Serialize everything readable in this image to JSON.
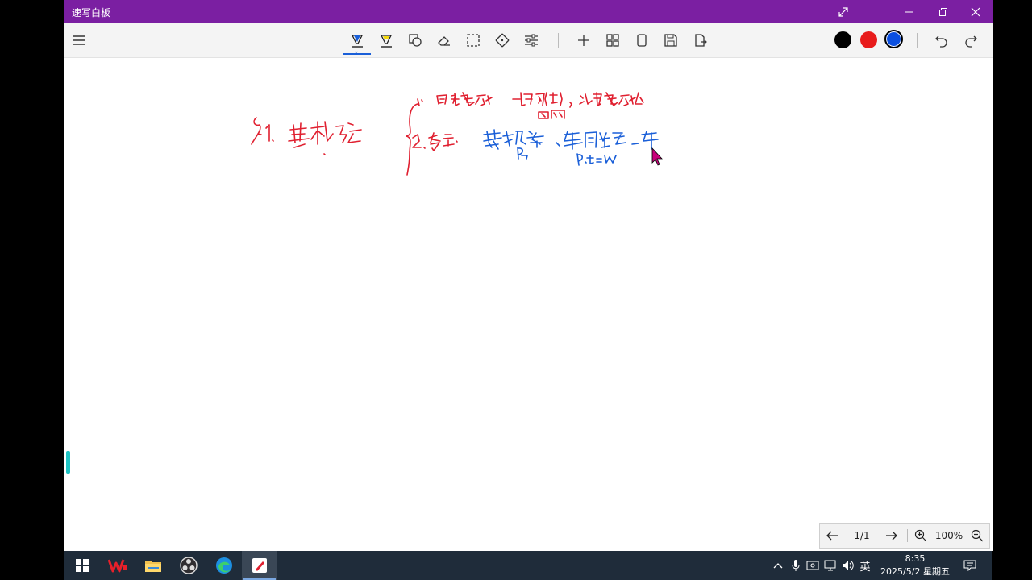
{
  "window": {
    "title": "速写白板"
  },
  "toolbar": {
    "tools": [
      {
        "name": "menu",
        "icon": "hamburger-icon"
      },
      {
        "name": "pen",
        "icon": "pen-icon",
        "active": true
      },
      {
        "name": "highlighter",
        "icon": "highlighter-icon"
      },
      {
        "name": "shapes",
        "icon": "shapes-icon"
      },
      {
        "name": "eraser",
        "icon": "eraser-icon"
      },
      {
        "name": "select",
        "icon": "lasso-select-icon"
      },
      {
        "name": "pan",
        "icon": "move-icon"
      },
      {
        "name": "settings",
        "icon": "sliders-icon"
      },
      {
        "name": "add",
        "icon": "plus-icon"
      },
      {
        "name": "pages",
        "icon": "grid-icon"
      },
      {
        "name": "page",
        "icon": "page-icon"
      },
      {
        "name": "save",
        "icon": "save-icon"
      },
      {
        "name": "export",
        "icon": "export-icon"
      }
    ],
    "colors": [
      {
        "name": "black",
        "hex": "#000000"
      },
      {
        "name": "red",
        "hex": "#e81c1c"
      },
      {
        "name": "blue",
        "hex": "#0a4fe0",
        "selected": true
      }
    ],
    "undo_icon": "undo-icon",
    "redo_icon": "redo-icon"
  },
  "canvas": {
    "ink_colors": {
      "red": "#e02030",
      "blue": "#1a5fd8"
    }
  },
  "pager": {
    "page_indicator": "1/1",
    "zoom": "100%"
  },
  "taskbar": {
    "apps": [
      "start-icon",
      "wps-icon",
      "file-explorer-icon",
      "obs-icon",
      "edge-icon",
      "whiteboard-icon"
    ],
    "tray_lang": "英",
    "time": "8:35",
    "date": "2025/5/2 星期五"
  }
}
